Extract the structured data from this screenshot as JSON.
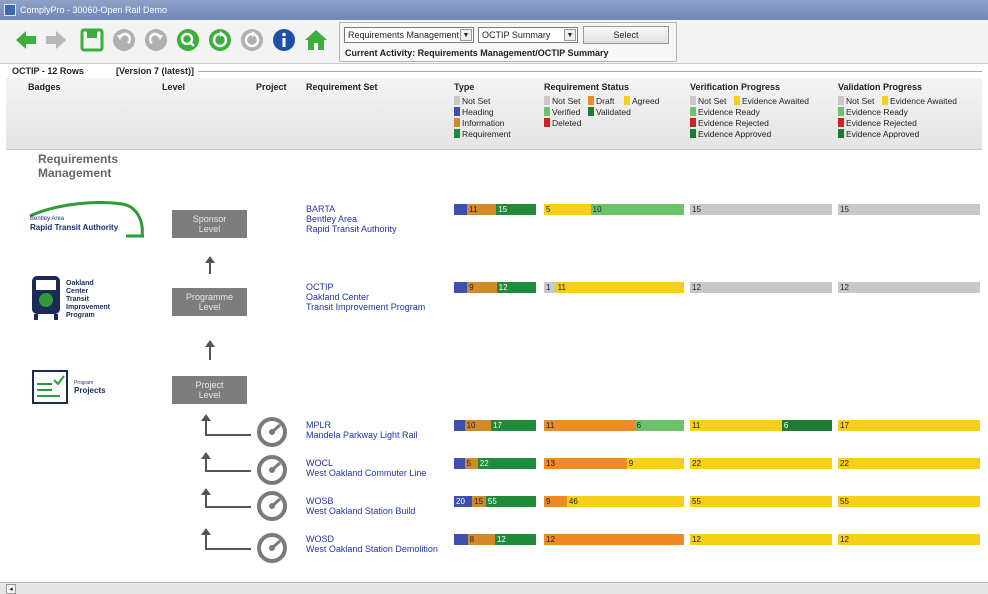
{
  "window": {
    "title": "ComplyPro - 30060-Open Rail Demo"
  },
  "toolbar": {
    "icons": [
      "back-arrow-icon",
      "forward-arrow-icon",
      "save-icon",
      "undo-icon",
      "redo-icon",
      "search-icon",
      "refresh-icon",
      "sync-icon",
      "info-icon",
      "home-icon"
    ]
  },
  "selector": {
    "module": "Requirements Management",
    "view": "OCTIP Summary",
    "select_label": "Select",
    "activity": "Current Activity: Requirements Management/OCTIP Summary"
  },
  "grid": {
    "rows_label": "OCTIP - 12 Rows",
    "version_label": "[Version 7 (latest)]",
    "columns": {
      "badges": "Badges",
      "level": "Level",
      "project": "Project",
      "requirement_set": "Requirement Set",
      "type": "Type",
      "status": "Requirement Status",
      "verification": "Verification Progress",
      "validation": "Validation Progress"
    },
    "legend": {
      "type": [
        {
          "label": "Not Set",
          "color": "#c8c8c8"
        },
        {
          "label": "Heading",
          "color": "#3f4fb0"
        },
        {
          "label": "Information",
          "color": "#d08a2a"
        },
        {
          "label": "Requirement",
          "color": "#1f8a3a"
        }
      ],
      "status": [
        {
          "label": "Not Set",
          "color": "#c8c8c8"
        },
        {
          "label": "Draft",
          "color": "#f08a24"
        },
        {
          "label": "Agreed",
          "color": "#f5cf1a"
        },
        {
          "label": "Verified",
          "color": "#6cc36c"
        },
        {
          "label": "Validated",
          "color": "#1f7a35"
        },
        {
          "label": "Deleted",
          "color": "#d02020"
        }
      ],
      "verification": [
        {
          "label": "Not Set",
          "color": "#c8c8c8"
        },
        {
          "label": "Evidence Awaited",
          "color": "#f5cf1a"
        },
        {
          "label": "Evidence Ready",
          "color": "#6cc36c"
        },
        {
          "label": "Evidence Rejected",
          "color": "#d02020"
        },
        {
          "label": "Evidence Approved",
          "color": "#1f7a35"
        }
      ],
      "validation": [
        {
          "label": "Not Set",
          "color": "#c8c8c8"
        },
        {
          "label": "Evidence Awaited",
          "color": "#f5cf1a"
        },
        {
          "label": "Evidence Ready",
          "color": "#6cc36c"
        },
        {
          "label": "Evidence Rejected",
          "color": "#d02020"
        },
        {
          "label": "Evidence Approved",
          "color": "#1f7a35"
        }
      ]
    }
  },
  "content": {
    "section_title": "Requirements\nManagement",
    "badges": {
      "barta": {
        "line1": "Bentley Area",
        "line2": "Rapid Transit Authority"
      },
      "octip": {
        "words": [
          "Oakland",
          "Center",
          "Transit",
          "Improvement",
          "Program"
        ]
      },
      "projects": {
        "small": "Program",
        "big": "Projects"
      }
    },
    "levels": [
      "Sponsor\nLevel",
      "Programme\nLevel",
      "Project\nLevel"
    ],
    "rows": [
      {
        "lines": [
          "BARTA",
          "Bentley Area",
          "Rapid Transit Authority"
        ],
        "type": [
          {
            "c": "#3f4fb0",
            "v": 5,
            "l": ""
          },
          {
            "c": "#d08a2a",
            "v": 11,
            "l": "11"
          },
          {
            "c": "#1f8a3a",
            "v": 15,
            "l": "15"
          }
        ],
        "status": [
          {
            "c": "#f5cf1a",
            "v": 5,
            "l": "5"
          },
          {
            "c": "#6cc36c",
            "v": 10,
            "l": "10"
          }
        ],
        "verification": [
          {
            "c": "#c8c8c8",
            "v": 15,
            "l": "15"
          }
        ],
        "validation": [
          {
            "c": "#c8c8c8",
            "v": 15,
            "l": "15"
          }
        ]
      },
      {
        "lines": [
          "OCTIP",
          "Oakland Center",
          "Transit Improvement Program"
        ],
        "type": [
          {
            "c": "#3f4fb0",
            "v": 4,
            "l": ""
          },
          {
            "c": "#d08a2a",
            "v": 9,
            "l": "9"
          },
          {
            "c": "#1f8a3a",
            "v": 12,
            "l": "12"
          }
        ],
        "status": [
          {
            "c": "#c8c8c8",
            "v": 1,
            "l": "1"
          },
          {
            "c": "#f5cf1a",
            "v": 11,
            "l": "11"
          }
        ],
        "verification": [
          {
            "c": "#c8c8c8",
            "v": 12,
            "l": "12"
          }
        ],
        "validation": [
          {
            "c": "#c8c8c8",
            "v": 12,
            "l": "12"
          }
        ]
      },
      {
        "lines": [
          "MPLR",
          "Mandela Parkway Light Rail"
        ],
        "type": [
          {
            "c": "#3f4fb0",
            "v": 4,
            "l": ""
          },
          {
            "c": "#d08a2a",
            "v": 10,
            "l": "10"
          },
          {
            "c": "#1f8a3a",
            "v": 17,
            "l": "17"
          }
        ],
        "status": [
          {
            "c": "#f08a24",
            "v": 11,
            "l": "11"
          },
          {
            "c": "#6cc36c",
            "v": 6,
            "l": "6"
          }
        ],
        "verification": [
          {
            "c": "#f5cf1a",
            "v": 11,
            "l": "11"
          },
          {
            "c": "#1f7a35",
            "v": 6,
            "l": "6"
          }
        ],
        "validation": [
          {
            "c": "#f5cf1a",
            "v": 17,
            "l": "17"
          }
        ]
      },
      {
        "lines": [
          "WOCL",
          "West Oakland Commuter Line"
        ],
        "type": [
          {
            "c": "#3f4fb0",
            "v": 4,
            "l": ""
          },
          {
            "c": "#d08a2a",
            "v": 5,
            "l": "5"
          },
          {
            "c": "#1f8a3a",
            "v": 22,
            "l": "22"
          }
        ],
        "status": [
          {
            "c": "#f08a24",
            "v": 13,
            "l": "13"
          },
          {
            "c": "#f5cf1a",
            "v": 9,
            "l": "9"
          }
        ],
        "verification": [
          {
            "c": "#f5cf1a",
            "v": 22,
            "l": "22"
          }
        ],
        "validation": [
          {
            "c": "#f5cf1a",
            "v": 22,
            "l": "22"
          }
        ]
      },
      {
        "lines": [
          "WOSB",
          "West Oakland Station Build"
        ],
        "type": [
          {
            "c": "#3f4fb0",
            "v": 20,
            "l": "20"
          },
          {
            "c": "#d08a2a",
            "v": 15,
            "l": "15"
          },
          {
            "c": "#1f8a3a",
            "v": 55,
            "l": "55"
          }
        ],
        "status": [
          {
            "c": "#f08a24",
            "v": 9,
            "l": "9"
          },
          {
            "c": "#f5cf1a",
            "v": 46,
            "l": "46"
          }
        ],
        "verification": [
          {
            "c": "#f5cf1a",
            "v": 55,
            "l": "55"
          }
        ],
        "validation": [
          {
            "c": "#f5cf1a",
            "v": 55,
            "l": "55"
          }
        ]
      },
      {
        "lines": [
          "WOSD",
          "West Oakland Station Demolition"
        ],
        "type": [
          {
            "c": "#3f4fb0",
            "v": 4,
            "l": ""
          },
          {
            "c": "#d08a2a",
            "v": 8,
            "l": "8"
          },
          {
            "c": "#1f8a3a",
            "v": 12,
            "l": "12"
          }
        ],
        "status": [
          {
            "c": "#f08a24",
            "v": 12,
            "l": "12"
          }
        ],
        "verification": [
          {
            "c": "#f5cf1a",
            "v": 12,
            "l": "12"
          }
        ],
        "validation": [
          {
            "c": "#f5cf1a",
            "v": 12,
            "l": "12"
          }
        ]
      }
    ]
  }
}
